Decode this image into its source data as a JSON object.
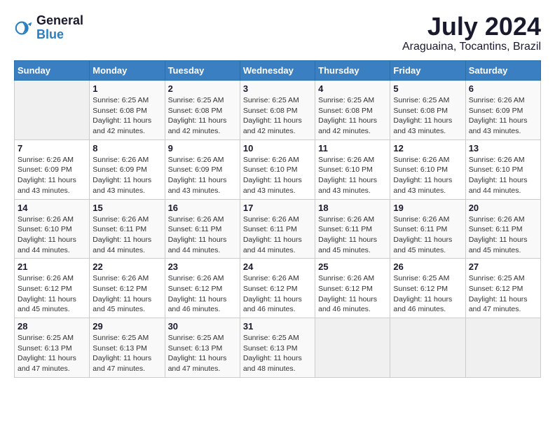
{
  "header": {
    "logo_line1": "General",
    "logo_line2": "Blue",
    "month": "July 2024",
    "location": "Araguaina, Tocantins, Brazil"
  },
  "days_of_week": [
    "Sunday",
    "Monday",
    "Tuesday",
    "Wednesday",
    "Thursday",
    "Friday",
    "Saturday"
  ],
  "weeks": [
    [
      {
        "day": "",
        "info": ""
      },
      {
        "day": "1",
        "info": "Sunrise: 6:25 AM\nSunset: 6:08 PM\nDaylight: 11 hours\nand 42 minutes."
      },
      {
        "day": "2",
        "info": "Sunrise: 6:25 AM\nSunset: 6:08 PM\nDaylight: 11 hours\nand 42 minutes."
      },
      {
        "day": "3",
        "info": "Sunrise: 6:25 AM\nSunset: 6:08 PM\nDaylight: 11 hours\nand 42 minutes."
      },
      {
        "day": "4",
        "info": "Sunrise: 6:25 AM\nSunset: 6:08 PM\nDaylight: 11 hours\nand 42 minutes."
      },
      {
        "day": "5",
        "info": "Sunrise: 6:25 AM\nSunset: 6:08 PM\nDaylight: 11 hours\nand 43 minutes."
      },
      {
        "day": "6",
        "info": "Sunrise: 6:26 AM\nSunset: 6:09 PM\nDaylight: 11 hours\nand 43 minutes."
      }
    ],
    [
      {
        "day": "7",
        "info": "Sunrise: 6:26 AM\nSunset: 6:09 PM\nDaylight: 11 hours\nand 43 minutes."
      },
      {
        "day": "8",
        "info": "Sunrise: 6:26 AM\nSunset: 6:09 PM\nDaylight: 11 hours\nand 43 minutes."
      },
      {
        "day": "9",
        "info": "Sunrise: 6:26 AM\nSunset: 6:09 PM\nDaylight: 11 hours\nand 43 minutes."
      },
      {
        "day": "10",
        "info": "Sunrise: 6:26 AM\nSunset: 6:10 PM\nDaylight: 11 hours\nand 43 minutes."
      },
      {
        "day": "11",
        "info": "Sunrise: 6:26 AM\nSunset: 6:10 PM\nDaylight: 11 hours\nand 43 minutes."
      },
      {
        "day": "12",
        "info": "Sunrise: 6:26 AM\nSunset: 6:10 PM\nDaylight: 11 hours\nand 43 minutes."
      },
      {
        "day": "13",
        "info": "Sunrise: 6:26 AM\nSunset: 6:10 PM\nDaylight: 11 hours\nand 44 minutes."
      }
    ],
    [
      {
        "day": "14",
        "info": "Sunrise: 6:26 AM\nSunset: 6:10 PM\nDaylight: 11 hours\nand 44 minutes."
      },
      {
        "day": "15",
        "info": "Sunrise: 6:26 AM\nSunset: 6:11 PM\nDaylight: 11 hours\nand 44 minutes."
      },
      {
        "day": "16",
        "info": "Sunrise: 6:26 AM\nSunset: 6:11 PM\nDaylight: 11 hours\nand 44 minutes."
      },
      {
        "day": "17",
        "info": "Sunrise: 6:26 AM\nSunset: 6:11 PM\nDaylight: 11 hours\nand 44 minutes."
      },
      {
        "day": "18",
        "info": "Sunrise: 6:26 AM\nSunset: 6:11 PM\nDaylight: 11 hours\nand 45 minutes."
      },
      {
        "day": "19",
        "info": "Sunrise: 6:26 AM\nSunset: 6:11 PM\nDaylight: 11 hours\nand 45 minutes."
      },
      {
        "day": "20",
        "info": "Sunrise: 6:26 AM\nSunset: 6:11 PM\nDaylight: 11 hours\nand 45 minutes."
      }
    ],
    [
      {
        "day": "21",
        "info": "Sunrise: 6:26 AM\nSunset: 6:12 PM\nDaylight: 11 hours\nand 45 minutes."
      },
      {
        "day": "22",
        "info": "Sunrise: 6:26 AM\nSunset: 6:12 PM\nDaylight: 11 hours\nand 45 minutes."
      },
      {
        "day": "23",
        "info": "Sunrise: 6:26 AM\nSunset: 6:12 PM\nDaylight: 11 hours\nand 46 minutes."
      },
      {
        "day": "24",
        "info": "Sunrise: 6:26 AM\nSunset: 6:12 PM\nDaylight: 11 hours\nand 46 minutes."
      },
      {
        "day": "25",
        "info": "Sunrise: 6:26 AM\nSunset: 6:12 PM\nDaylight: 11 hours\nand 46 minutes."
      },
      {
        "day": "26",
        "info": "Sunrise: 6:25 AM\nSunset: 6:12 PM\nDaylight: 11 hours\nand 46 minutes."
      },
      {
        "day": "27",
        "info": "Sunrise: 6:25 AM\nSunset: 6:12 PM\nDaylight: 11 hours\nand 47 minutes."
      }
    ],
    [
      {
        "day": "28",
        "info": "Sunrise: 6:25 AM\nSunset: 6:13 PM\nDaylight: 11 hours\nand 47 minutes."
      },
      {
        "day": "29",
        "info": "Sunrise: 6:25 AM\nSunset: 6:13 PM\nDaylight: 11 hours\nand 47 minutes."
      },
      {
        "day": "30",
        "info": "Sunrise: 6:25 AM\nSunset: 6:13 PM\nDaylight: 11 hours\nand 47 minutes."
      },
      {
        "day": "31",
        "info": "Sunrise: 6:25 AM\nSunset: 6:13 PM\nDaylight: 11 hours\nand 48 minutes."
      },
      {
        "day": "",
        "info": ""
      },
      {
        "day": "",
        "info": ""
      },
      {
        "day": "",
        "info": ""
      }
    ]
  ]
}
